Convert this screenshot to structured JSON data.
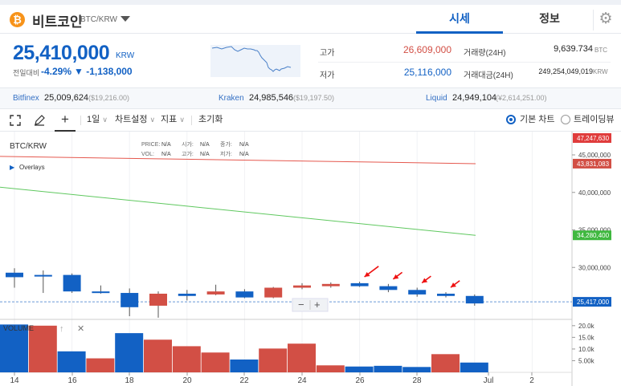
{
  "header": {
    "coin_symbol": "₿",
    "coin_name": "비트코인",
    "pair": "BTC/KRW",
    "tabs": [
      "시세",
      "정보"
    ]
  },
  "summary": {
    "price": "25,410,000",
    "currency": "KRW",
    "change_label": "전일대비",
    "change_pct": "-4.29%",
    "change_abs": "▼ -1,138,000",
    "high_label": "고가",
    "high_value": "26,609,000",
    "low_label": "저가",
    "low_value": "25,116,000",
    "volume_label": "거래량(24H)",
    "volume_value": "9,639.734",
    "volume_unit": "BTC",
    "amount_label": "거래대금(24H)",
    "amount_value": "249,254,049,019",
    "amount_unit": "KRW"
  },
  "exchanges": [
    {
      "name": "Bitfinex",
      "value": "25,009,624",
      "usd": "($19,216.00)"
    },
    {
      "name": "Kraken",
      "value": "24,985,546",
      "usd": "($19,197.50)"
    },
    {
      "name": "Liquid",
      "value": "24,949,104",
      "usd": "(¥2,614,251.00)"
    }
  ],
  "toolbar": {
    "interval": "1일",
    "chart_settings": "차트설정",
    "indicators": "지표",
    "reset": "초기화",
    "basic_chart": "기본 차트",
    "tradingview": "트레이딩뷰"
  },
  "chart": {
    "symbol": "BTC/KRW",
    "overlays": "Overlays",
    "legend_price": "PRICE:",
    "legend_open": "시가:",
    "legend_high": "종가:",
    "legend_vol": "VOL:",
    "legend_h": "고가:",
    "legend_l": "저가:",
    "na": "N/A",
    "volume_label": "VOLUME",
    "zoom_minus": "−",
    "zoom_plus": "+",
    "close_x": "✕",
    "up_arrow": "↑"
  },
  "colors": {
    "up": "#d24f45",
    "down": "#1261c4",
    "accent": "#1261c4"
  },
  "chart_data": {
    "type": "candlestick",
    "price_axis_ticks": [
      "45,000,000",
      "40,000,000",
      "35,000,000",
      "30,000,000"
    ],
    "price_ylim": [
      25000000,
      47247630
    ],
    "price_tags": [
      {
        "value": "47,247,630",
        "color": "#e03c3c"
      },
      {
        "value": "43,831,083",
        "color": "#d24f45"
      },
      {
        "value": "34,280,400",
        "color": "#3fb83f"
      },
      {
        "value": "25,417,000",
        "color": "#1261c4"
      }
    ],
    "volume_axis_ticks": [
      "20.0k",
      "15.0k",
      "10.0k",
      "5.00k"
    ],
    "x_ticks": [
      "14",
      "16",
      "18",
      "20",
      "22",
      "24",
      "26",
      "28",
      "Jul",
      "2"
    ],
    "candles": [
      {
        "o": 29300000,
        "c": 28700000,
        "h": 29900000,
        "l": 27300000
      },
      {
        "o": 29000000,
        "c": 28800000,
        "h": 29600000,
        "l": 26600000
      },
      {
        "o": 29000000,
        "c": 26800000,
        "h": 29200000,
        "l": 26600000
      },
      {
        "o": 26800000,
        "c": 26700000,
        "h": 27600000,
        "l": 26500000
      },
      {
        "o": 26600000,
        "c": 24700000,
        "h": 27200000,
        "l": 23500000
      },
      {
        "o": 24900000,
        "c": 26500000,
        "h": 26800000,
        "l": 23300000
      },
      {
        "o": 26500000,
        "c": 26200000,
        "h": 27000000,
        "l": 25600000
      },
      {
        "o": 26400000,
        "c": 26800000,
        "h": 27700000,
        "l": 26300000
      },
      {
        "o": 26800000,
        "c": 26000000,
        "h": 27100000,
        "l": 25900000
      },
      {
        "o": 26000000,
        "c": 27300000,
        "h": 27400000,
        "l": 25900000
      },
      {
        "o": 27300000,
        "c": 27600000,
        "h": 27900000,
        "l": 27100000
      },
      {
        "o": 27500000,
        "c": 27800000,
        "h": 28000000,
        "l": 27300000
      },
      {
        "o": 27900000,
        "c": 27500000,
        "h": 28100000,
        "l": 27400000
      },
      {
        "o": 27500000,
        "c": 27000000,
        "h": 27800000,
        "l": 26700000
      },
      {
        "o": 27000000,
        "c": 26400000,
        "h": 27300000,
        "l": 26100000
      },
      {
        "o": 26500000,
        "c": 26200000,
        "h": 26700000,
        "l": 26000000
      },
      {
        "o": 26200000,
        "c": 25200000,
        "h": 26400000,
        "l": 24900000
      }
    ],
    "volumes": [
      {
        "v": 20500,
        "up": false
      },
      {
        "v": 20000,
        "up": true
      },
      {
        "v": 9000,
        "up": false
      },
      {
        "v": 6000,
        "up": true
      },
      {
        "v": 16800,
        "up": false
      },
      {
        "v": 14000,
        "up": true
      },
      {
        "v": 11200,
        "up": true
      },
      {
        "v": 8500,
        "up": true
      },
      {
        "v": 5500,
        "up": false
      },
      {
        "v": 10200,
        "up": true
      },
      {
        "v": 12300,
        "up": true
      },
      {
        "v": 3000,
        "up": true
      },
      {
        "v": 2500,
        "up": false
      },
      {
        "v": 2800,
        "up": false
      },
      {
        "v": 2300,
        "up": false
      },
      {
        "v": 7800,
        "up": true
      },
      {
        "v": 4200,
        "up": false
      }
    ],
    "ma_red": [
      44800000,
      43831083
    ],
    "ma_green": [
      40700000,
      34280400
    ],
    "current_price": 25417000
  }
}
